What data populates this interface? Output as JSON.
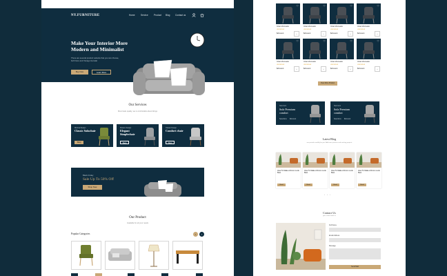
{
  "left": {
    "logo": "NY.FURNITURE",
    "nav": [
      "Home",
      "Service",
      "Product",
      "Blog",
      "Contact us"
    ],
    "hero": {
      "title": "Make Your Interior More Modern and Minimalist",
      "subtitle": "There are several product variants that you can choose, both here and Yanago Gunstat",
      "buy_label": "Buy Now",
      "learn_label": "Learn More"
    },
    "services": {
      "title": "Our Services",
      "subtitle": "Most trade quality, we is comfortable about likings",
      "cards": [
        {
          "label": "Minimal Design",
          "title": "Classic Sofachair",
          "button": "Shop"
        },
        {
          "label": "Modern Design",
          "title": "Elegant Simplechair",
          "button": "Shop"
        },
        {
          "label": "Classic Design",
          "title": "Comfort chair",
          "button": "Shop"
        }
      ]
    },
    "banner": {
      "label": "Black Friday",
      "title": "Sale Up To 50% Off",
      "button": "Shop Now"
    },
    "product": {
      "title": "Our Product",
      "subtitle": "Available for all your needs",
      "categories_label": "Popular Categories"
    }
  },
  "right": {
    "cards": [
      {
        "name": "Chair Minimalist",
        "stars": "★★★★★",
        "price": "$Amount"
      },
      {
        "name": "Chair Minimalist",
        "stars": "★★★★★",
        "price": "$Amount"
      },
      {
        "name": "Chair Minimalist",
        "stars": "★★★★★",
        "price": "$Amount"
      },
      {
        "name": "Chair Minimalist",
        "stars": "★★★★★",
        "price": "$Amount"
      },
      {
        "name": "Chair Minimalist",
        "stars": "★★★★★",
        "price": "$Amount"
      },
      {
        "name": "Chair Minimalist",
        "stars": "★★★★★",
        "price": "$Amount"
      },
      {
        "name": "Chair Minimalist",
        "stars": "★★★★★",
        "price": "$Amount"
      },
      {
        "name": "Chair Minimalist",
        "stars": "★★★★★",
        "price": "$Amount"
      }
    ],
    "view_more": "View More Product",
    "promos": [
      {
        "label": "New Item",
        "title": "Sofa Premium comfort",
        "link": "Selections",
        "price": "$Amount"
      },
      {
        "label": "New Item",
        "title": "Sofa Premium comfort",
        "link": "Selections",
        "price": "$Amount"
      }
    ],
    "blog": {
      "title": "Latest Blog",
      "subtitle": "are posted carefully for you. Add more pictures and exciting projects",
      "posts": [
        {
          "title": "How To Make A Room Look Best",
          "button": "Read"
        },
        {
          "title": "How To Make A Room Look Best",
          "button": "Read"
        },
        {
          "title": "How To Make A Room Look Best",
          "button": "Read"
        },
        {
          "title": "How To Make A Room Look Best",
          "button": "Read"
        }
      ]
    },
    "contact": {
      "title": "Contact Us",
      "subtitle": "get in touch with us",
      "fields": [
        "Full Name",
        "Email Address",
        "Message"
      ],
      "submit": "Send Mail"
    }
  }
}
